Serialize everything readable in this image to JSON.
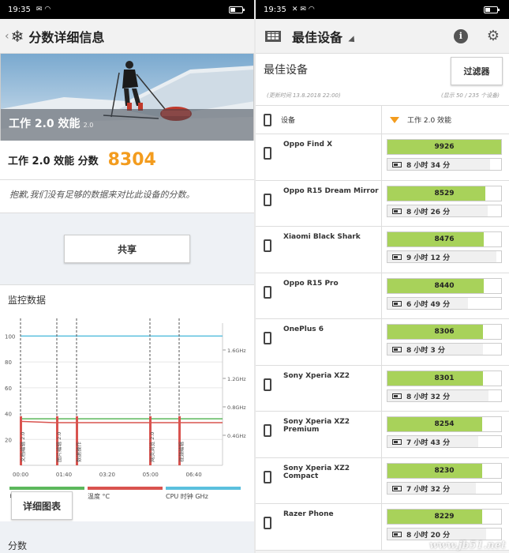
{
  "left": {
    "status_time": "19:35",
    "title": "分数详细信息",
    "hero_title": "工作 2.0 效能",
    "hero_version": "2.0",
    "score_label": "工作 2.0 效能 分数",
    "score_value": "8304",
    "notice": "抱歉,我们没有足够的数据来对比此设备的分数。",
    "share_label": "共享",
    "monitor_title": "监控数据",
    "detail_button": "详细图表",
    "bottom_title": "分数",
    "chart_data": {
      "type": "line",
      "x_ticks": [
        "00:00",
        "01:40",
        "03:20",
        "05:00",
        "06:40"
      ],
      "y_left_ticks": [
        "100",
        "80",
        "60",
        "40",
        "20"
      ],
      "y_right_ticks": [
        "1.6GHz",
        "1.2GHz",
        "0.8GHz",
        "0.4GHz"
      ],
      "markers": [
        "文档编辑 2.0",
        "图片编辑 2.0",
        "数据操作",
        "网页浏览 2.0",
        "视频编辑"
      ],
      "legend": [
        {
          "label": "电池电量 %",
          "color": "#5cb85c"
        },
        {
          "label": "温度 °C",
          "color": "#d9534f"
        },
        {
          "label": "CPU 时钟 GHz",
          "color": "#5bc0de"
        }
      ],
      "series": [
        {
          "name": "电池电量 %",
          "color": "#5cb85c",
          "values": [
            36,
            36,
            36,
            36,
            36,
            36,
            36
          ]
        },
        {
          "name": "温度 °C",
          "color": "#d9534f",
          "values": [
            34,
            33,
            33,
            33,
            33,
            33,
            33
          ]
        },
        {
          "name": "CPU 时钟 GHz",
          "color": "#5bc0de",
          "values": [
            100,
            100,
            100,
            100,
            100,
            100,
            100
          ]
        }
      ]
    }
  },
  "right": {
    "status_time": "19:35",
    "title": "最佳设备",
    "info_icon": "i",
    "best_title": "最佳设备",
    "updated": "(更新时间 13.8.2018 22:00)",
    "showing": "(显示 50 / 235 个设备)",
    "filter_label": "过滤器",
    "col_device": "设备",
    "col_perf": "工作 2.0 效能",
    "devices": [
      {
        "name": "Oppo Find X",
        "score": "9926",
        "fill": 1.0,
        "battery": "8 小时 34 分",
        "batt_fill": 0.9
      },
      {
        "name": "Oppo R15 Dream Mirror",
        "score": "8529",
        "fill": 0.86,
        "battery": "8 小时 26 分",
        "batt_fill": 0.88
      },
      {
        "name": "Xiaomi Black Shark",
        "score": "8476",
        "fill": 0.85,
        "battery": "9 小时 12 分",
        "batt_fill": 0.96
      },
      {
        "name": "Oppo R15 Pro",
        "score": "8440",
        "fill": 0.85,
        "battery": "6 小时 49 分",
        "batt_fill": 0.71
      },
      {
        "name": "OnePlus 6",
        "score": "8306",
        "fill": 0.84,
        "battery": "8 小时 3 分",
        "batt_fill": 0.84
      },
      {
        "name": "Sony Xperia XZ2",
        "score": "8301",
        "fill": 0.84,
        "battery": "8 小时 32 分",
        "batt_fill": 0.89
      },
      {
        "name": "Sony Xperia XZ2 Premium",
        "score": "8254",
        "fill": 0.83,
        "battery": "7 小时 43 分",
        "batt_fill": 0.8
      },
      {
        "name": "Sony Xperia XZ2 Compact",
        "score": "8230",
        "fill": 0.83,
        "battery": "7 小时 32 分",
        "batt_fill": 0.78
      },
      {
        "name": "Razer Phone",
        "score": "8229",
        "fill": 0.83,
        "battery": "8 小时 20 分",
        "batt_fill": 0.87
      }
    ],
    "watermark": "www.jb51.net"
  }
}
